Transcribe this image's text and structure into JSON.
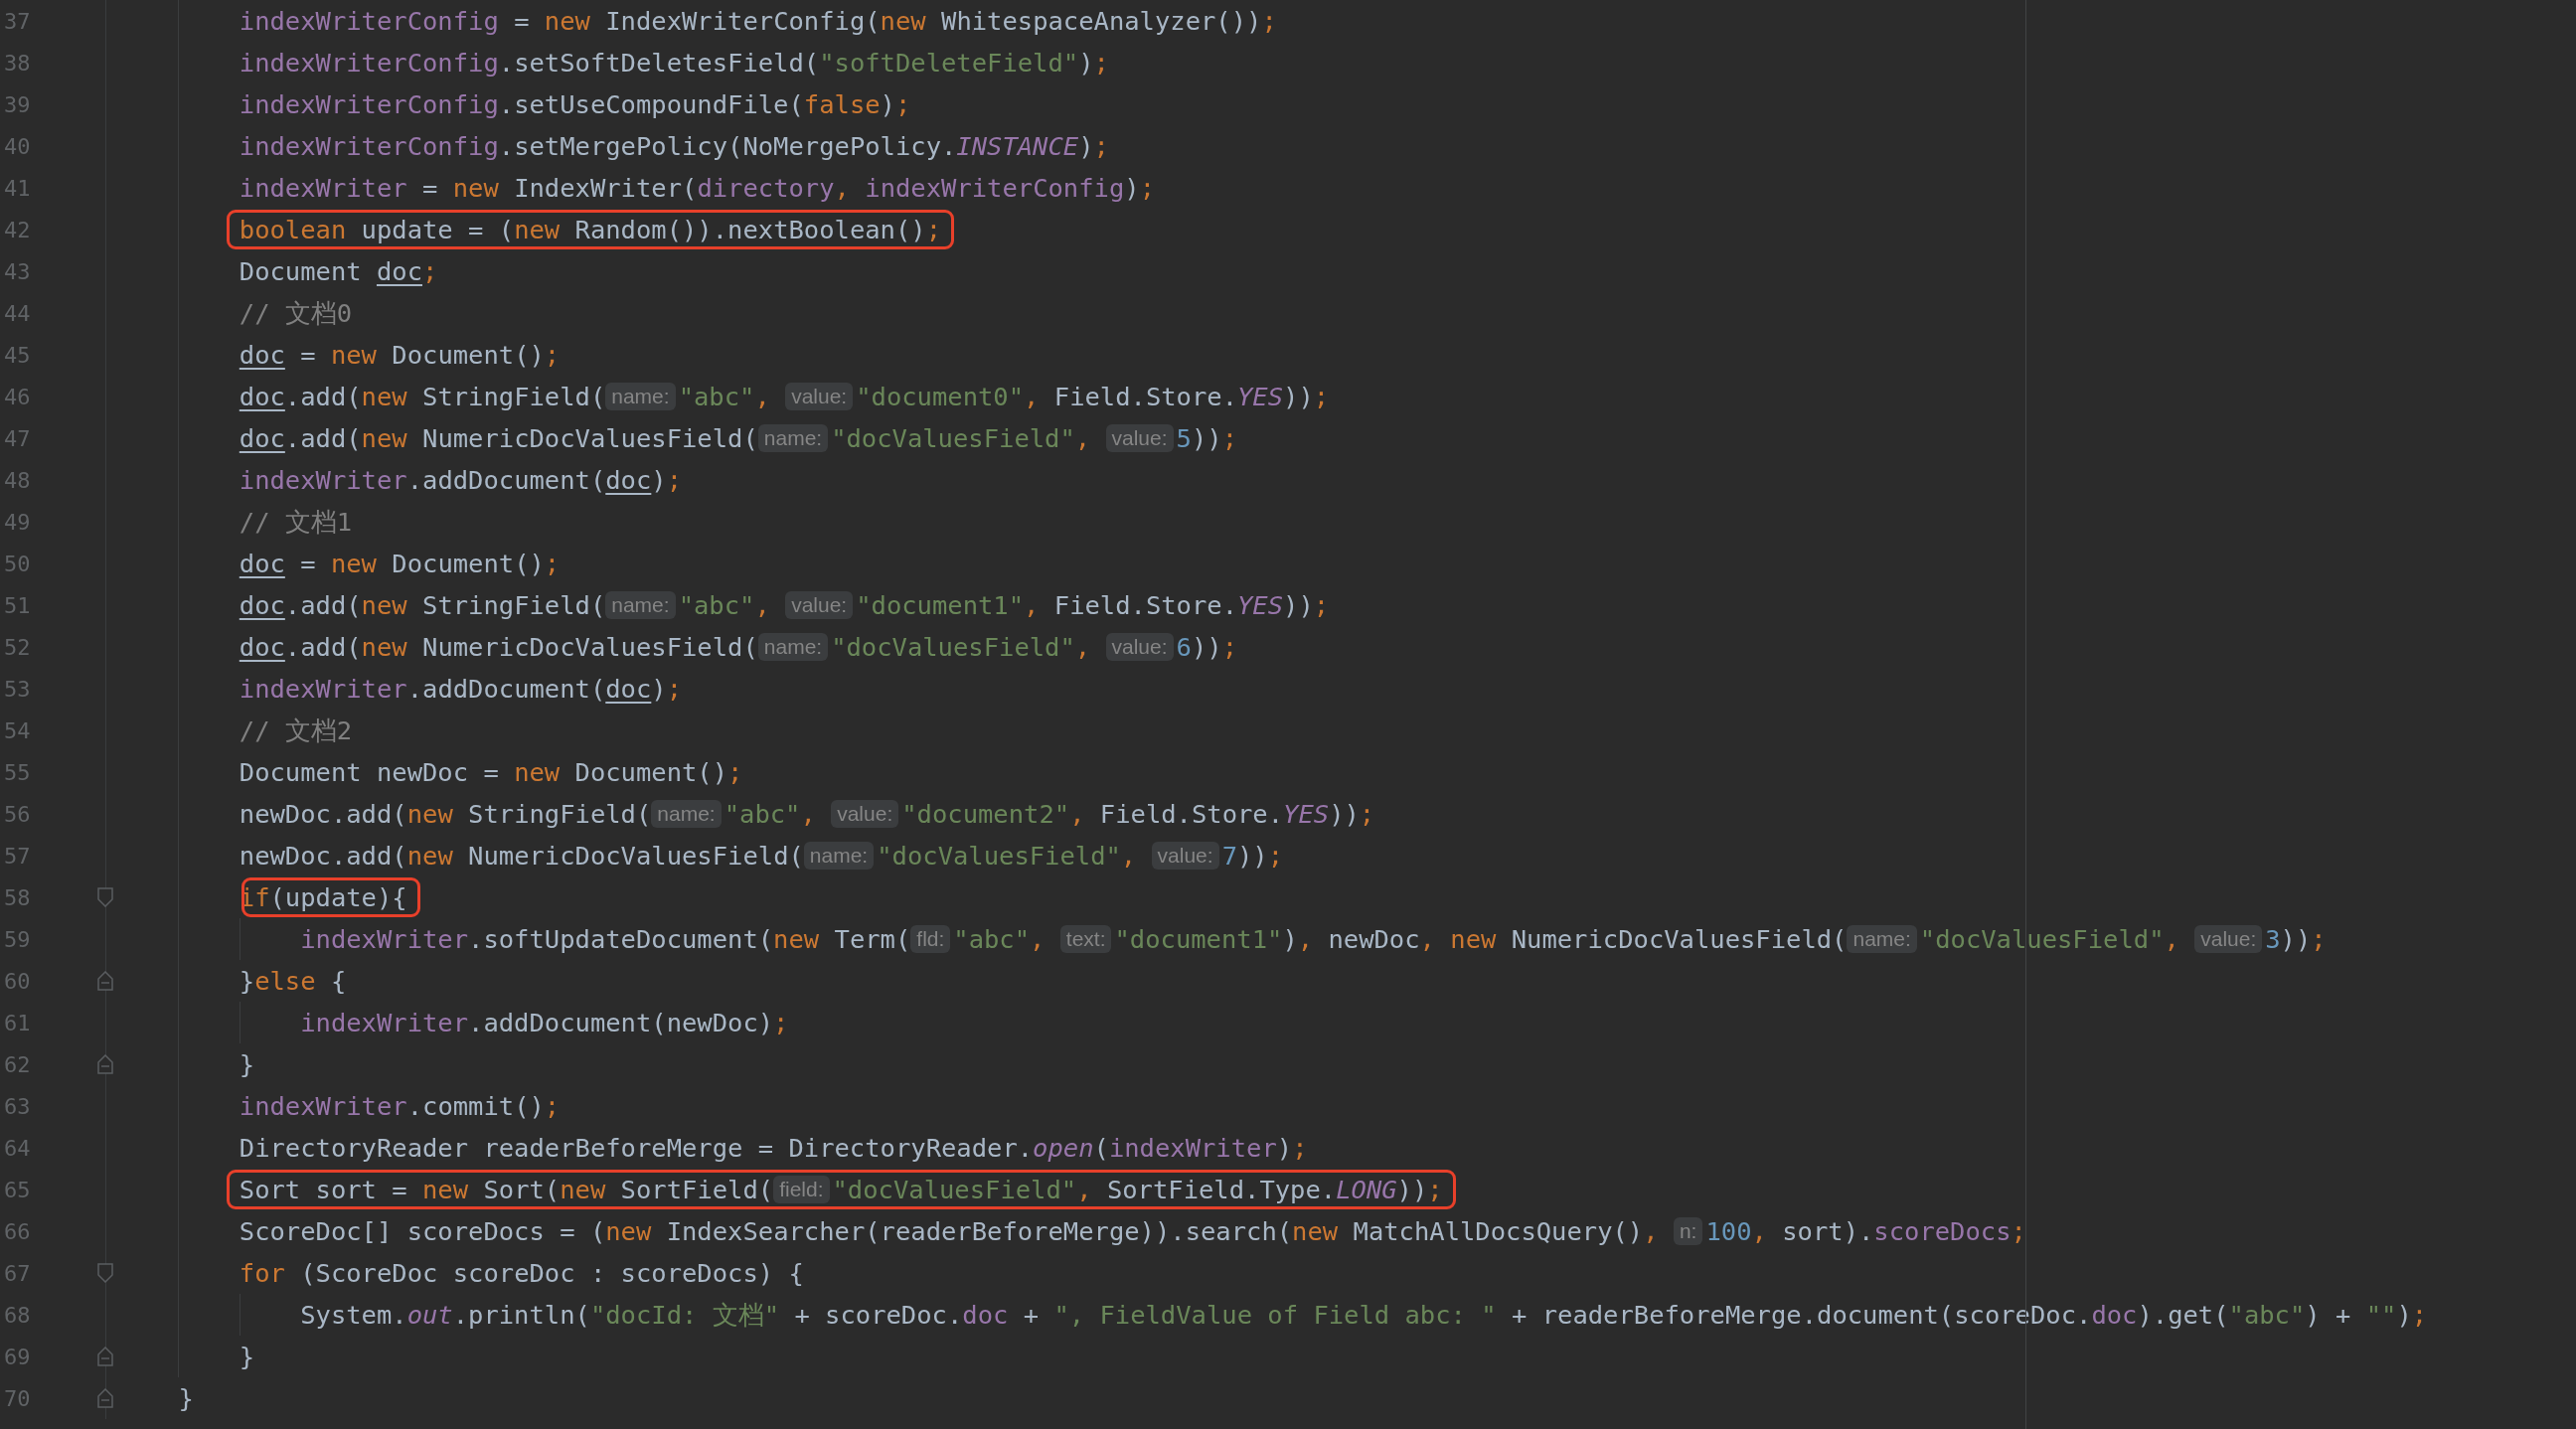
{
  "editor": {
    "lines": [
      {
        "number": "37",
        "kind": "statement",
        "tokens": [
          {
            "kind": "field",
            "t": "indexWriterConfig"
          },
          {
            "kind": "plain",
            "t": " = "
          },
          {
            "kind": "keyword",
            "t": "new"
          },
          {
            "kind": "plain",
            "t": " IndexWriterConfig("
          },
          {
            "kind": "keyword",
            "t": "new"
          },
          {
            "kind": "plain",
            "t": " WhitespaceAnalyzer())"
          },
          {
            "kind": "keyword",
            "t": ";"
          }
        ]
      },
      {
        "number": "38",
        "kind": "statement",
        "tokens": [
          {
            "kind": "field",
            "t": "indexWriterConfig"
          },
          {
            "kind": "plain",
            "t": ".setSoftDeletesField("
          },
          {
            "kind": "string",
            "t": "\"softDeleteField\""
          },
          {
            "kind": "plain",
            "t": ")"
          },
          {
            "kind": "keyword",
            "t": ";"
          }
        ]
      },
      {
        "number": "39",
        "kind": "statement",
        "tokens": [
          {
            "kind": "field",
            "t": "indexWriterConfig"
          },
          {
            "kind": "plain",
            "t": ".setUseCompoundFile("
          },
          {
            "kind": "keyword",
            "t": "false"
          },
          {
            "kind": "plain",
            "t": ")"
          },
          {
            "kind": "keyword",
            "t": ";"
          }
        ]
      },
      {
        "number": "40",
        "kind": "statement",
        "tokens": [
          {
            "kind": "field",
            "t": "indexWriterConfig"
          },
          {
            "kind": "plain",
            "t": ".setMergePolicy(NoMergePolicy."
          },
          {
            "kind": "static",
            "t": "INSTANCE"
          },
          {
            "kind": "plain",
            "t": ")"
          },
          {
            "kind": "keyword",
            "t": ";"
          }
        ]
      },
      {
        "number": "41",
        "kind": "statement",
        "tokens": [
          {
            "kind": "field",
            "t": "indexWriter"
          },
          {
            "kind": "plain",
            "t": " = "
          },
          {
            "kind": "keyword",
            "t": "new"
          },
          {
            "kind": "plain",
            "t": " IndexWriter("
          },
          {
            "kind": "field",
            "t": "directory"
          },
          {
            "kind": "keyword",
            "t": ", "
          },
          {
            "kind": "field",
            "t": "indexWriterConfig"
          },
          {
            "kind": "plain",
            "t": ")"
          },
          {
            "kind": "keyword",
            "t": ";"
          }
        ]
      },
      {
        "number": "42",
        "kind": "statement",
        "tokens": [
          {
            "kind": "box",
            "tokens": [
              {
                "kind": "keyword",
                "t": "boolean"
              },
              {
                "kind": "plain",
                "t": " update = ("
              },
              {
                "kind": "keyword",
                "t": "new"
              },
              {
                "kind": "plain",
                "t": " Random()).nextBoolean()"
              },
              {
                "kind": "keyword",
                "t": ";"
              }
            ]
          }
        ]
      },
      {
        "number": "43",
        "kind": "statement",
        "tokens": [
          {
            "kind": "plain",
            "t": "Document "
          },
          {
            "kind": "variable",
            "t": "doc"
          },
          {
            "kind": "keyword",
            "t": ";"
          }
        ]
      },
      {
        "number": "44",
        "kind": "statement",
        "tokens": [
          {
            "kind": "comment",
            "t": "// 文档0"
          }
        ]
      },
      {
        "number": "45",
        "kind": "statement",
        "tokens": [
          {
            "kind": "variable",
            "t": "doc"
          },
          {
            "kind": "plain",
            "t": " = "
          },
          {
            "kind": "keyword",
            "t": "new"
          },
          {
            "kind": "plain",
            "t": " Document()"
          },
          {
            "kind": "keyword",
            "t": ";"
          }
        ]
      },
      {
        "number": "46",
        "kind": "statement",
        "tokens": [
          {
            "kind": "variable",
            "t": "doc"
          },
          {
            "kind": "plain",
            "t": ".add("
          },
          {
            "kind": "keyword",
            "t": "new"
          },
          {
            "kind": "plain",
            "t": " StringField("
          },
          {
            "kind": "hint",
            "t": "name:"
          },
          {
            "kind": "string",
            "t": "\"abc\""
          },
          {
            "kind": "keyword",
            "t": ", "
          },
          {
            "kind": "hint",
            "t": "value:"
          },
          {
            "kind": "string",
            "t": "\"document0\""
          },
          {
            "kind": "keyword",
            "t": ", "
          },
          {
            "kind": "plain",
            "t": "Field.Store."
          },
          {
            "kind": "static",
            "t": "YES"
          },
          {
            "kind": "plain",
            "t": "))"
          },
          {
            "kind": "keyword",
            "t": ";"
          }
        ]
      },
      {
        "number": "47",
        "kind": "statement",
        "tokens": [
          {
            "kind": "variable",
            "t": "doc"
          },
          {
            "kind": "plain",
            "t": ".add("
          },
          {
            "kind": "keyword",
            "t": "new"
          },
          {
            "kind": "plain",
            "t": " NumericDocValuesField("
          },
          {
            "kind": "hint",
            "t": "name:"
          },
          {
            "kind": "string",
            "t": "\"docValuesField\""
          },
          {
            "kind": "keyword",
            "t": ", "
          },
          {
            "kind": "hint",
            "t": "value:"
          },
          {
            "kind": "number",
            "t": "5"
          },
          {
            "kind": "plain",
            "t": "))"
          },
          {
            "kind": "keyword",
            "t": ";"
          }
        ]
      },
      {
        "number": "48",
        "kind": "statement",
        "tokens": [
          {
            "kind": "field",
            "t": "indexWriter"
          },
          {
            "kind": "plain",
            "t": ".addDocument("
          },
          {
            "kind": "variable",
            "t": "doc"
          },
          {
            "kind": "plain",
            "t": ")"
          },
          {
            "kind": "keyword",
            "t": ";"
          }
        ]
      },
      {
        "number": "49",
        "kind": "statement",
        "tokens": [
          {
            "kind": "comment",
            "t": "// 文档1"
          }
        ]
      },
      {
        "number": "50",
        "kind": "statement",
        "tokens": [
          {
            "kind": "variable",
            "t": "doc"
          },
          {
            "kind": "plain",
            "t": " = "
          },
          {
            "kind": "keyword",
            "t": "new"
          },
          {
            "kind": "plain",
            "t": " Document()"
          },
          {
            "kind": "keyword",
            "t": ";"
          }
        ]
      },
      {
        "number": "51",
        "kind": "statement",
        "tokens": [
          {
            "kind": "variable",
            "t": "doc"
          },
          {
            "kind": "plain",
            "t": ".add("
          },
          {
            "kind": "keyword",
            "t": "new"
          },
          {
            "kind": "plain",
            "t": " StringField("
          },
          {
            "kind": "hint",
            "t": "name:"
          },
          {
            "kind": "string",
            "t": "\"abc\""
          },
          {
            "kind": "keyword",
            "t": ", "
          },
          {
            "kind": "hint",
            "t": "value:"
          },
          {
            "kind": "string",
            "t": "\"document1\""
          },
          {
            "kind": "keyword",
            "t": ", "
          },
          {
            "kind": "plain",
            "t": "Field.Store."
          },
          {
            "kind": "static",
            "t": "YES"
          },
          {
            "kind": "plain",
            "t": "))"
          },
          {
            "kind": "keyword",
            "t": ";"
          }
        ]
      },
      {
        "number": "52",
        "kind": "statement",
        "tokens": [
          {
            "kind": "variable",
            "t": "doc"
          },
          {
            "kind": "plain",
            "t": ".add("
          },
          {
            "kind": "keyword",
            "t": "new"
          },
          {
            "kind": "plain",
            "t": " NumericDocValuesField("
          },
          {
            "kind": "hint",
            "t": "name:"
          },
          {
            "kind": "string",
            "t": "\"docValuesField\""
          },
          {
            "kind": "keyword",
            "t": ", "
          },
          {
            "kind": "hint",
            "t": "value:"
          },
          {
            "kind": "number",
            "t": "6"
          },
          {
            "kind": "plain",
            "t": "))"
          },
          {
            "kind": "keyword",
            "t": ";"
          }
        ]
      },
      {
        "number": "53",
        "kind": "statement",
        "tokens": [
          {
            "kind": "field",
            "t": "indexWriter"
          },
          {
            "kind": "plain",
            "t": ".addDocument("
          },
          {
            "kind": "variable",
            "t": "doc"
          },
          {
            "kind": "plain",
            "t": ")"
          },
          {
            "kind": "keyword",
            "t": ";"
          }
        ]
      },
      {
        "number": "54",
        "kind": "statement",
        "tokens": [
          {
            "kind": "comment",
            "t": "// 文档2"
          }
        ]
      },
      {
        "number": "55",
        "kind": "statement",
        "tokens": [
          {
            "kind": "plain",
            "t": "Document newDoc = "
          },
          {
            "kind": "keyword",
            "t": "new"
          },
          {
            "kind": "plain",
            "t": " Document()"
          },
          {
            "kind": "keyword",
            "t": ";"
          }
        ]
      },
      {
        "number": "56",
        "kind": "statement",
        "tokens": [
          {
            "kind": "plain",
            "t": "newDoc.add("
          },
          {
            "kind": "keyword",
            "t": "new"
          },
          {
            "kind": "plain",
            "t": " StringField("
          },
          {
            "kind": "hint",
            "t": "name:"
          },
          {
            "kind": "string",
            "t": "\"abc\""
          },
          {
            "kind": "keyword",
            "t": ", "
          },
          {
            "kind": "hint",
            "t": "value:"
          },
          {
            "kind": "string",
            "t": "\"document2\""
          },
          {
            "kind": "keyword",
            "t": ", "
          },
          {
            "kind": "plain",
            "t": "Field.Store."
          },
          {
            "kind": "static",
            "t": "YES"
          },
          {
            "kind": "plain",
            "t": "))"
          },
          {
            "kind": "keyword",
            "t": ";"
          }
        ]
      },
      {
        "number": "57",
        "kind": "statement",
        "tokens": [
          {
            "kind": "plain",
            "t": "newDoc.add("
          },
          {
            "kind": "keyword",
            "t": "new"
          },
          {
            "kind": "plain",
            "t": " NumericDocValuesField("
          },
          {
            "kind": "hint",
            "t": "name:"
          },
          {
            "kind": "string",
            "t": "\"docValuesField\""
          },
          {
            "kind": "keyword",
            "t": ", "
          },
          {
            "kind": "hint",
            "t": "value:"
          },
          {
            "kind": "number",
            "t": "7"
          },
          {
            "kind": "plain",
            "t": "))"
          },
          {
            "kind": "keyword",
            "t": ";"
          }
        ]
      },
      {
        "number": "58",
        "kind": "statement",
        "fold_marker": {
          "kind": "open"
        },
        "tokens": [
          {
            "kind": "keyword",
            "t": "i"
          },
          {
            "kind": "box",
            "tokens": [
              {
                "kind": "keyword",
                "t": "f"
              },
              {
                "kind": "plain",
                "t": "(update){"
              }
            ]
          }
        ]
      },
      {
        "number": "59",
        "kind": "nested",
        "tokens": [
          {
            "kind": "field",
            "t": "indexWriter"
          },
          {
            "kind": "plain",
            "t": ".softUpdateDocument("
          },
          {
            "kind": "keyword",
            "t": "new"
          },
          {
            "kind": "plain",
            "t": " Term("
          },
          {
            "kind": "hint",
            "t": "fld:"
          },
          {
            "kind": "string",
            "t": "\"abc\""
          },
          {
            "kind": "keyword",
            "t": ", "
          },
          {
            "kind": "hint",
            "t": "text:"
          },
          {
            "kind": "string",
            "t": "\"document1\""
          },
          {
            "kind": "plain",
            "t": ")"
          },
          {
            "kind": "keyword",
            "t": ", "
          },
          {
            "kind": "plain",
            "t": "newDoc"
          },
          {
            "kind": "keyword",
            "t": ", "
          },
          {
            "kind": "keyword",
            "t": "new"
          },
          {
            "kind": "plain",
            "t": " NumericDocValuesField("
          },
          {
            "kind": "hint",
            "t": "name:"
          },
          {
            "kind": "string",
            "t": "\"docValuesField\""
          },
          {
            "kind": "keyword",
            "t": ", "
          },
          {
            "kind": "hint",
            "t": "value:"
          },
          {
            "kind": "number",
            "t": "3"
          },
          {
            "kind": "plain",
            "t": "))"
          },
          {
            "kind": "keyword",
            "t": ";"
          }
        ]
      },
      {
        "number": "60",
        "kind": "statement",
        "fold_marker": {
          "kind": "close"
        },
        "tokens": [
          {
            "kind": "plain",
            "t": "}"
          },
          {
            "kind": "keyword",
            "t": "else"
          },
          {
            "kind": "plain",
            "t": " {"
          }
        ]
      },
      {
        "number": "61",
        "kind": "nested",
        "tokens": [
          {
            "kind": "field",
            "t": "indexWriter"
          },
          {
            "kind": "plain",
            "t": ".addDocument(newDoc)"
          },
          {
            "kind": "keyword",
            "t": ";"
          }
        ]
      },
      {
        "number": "62",
        "kind": "statement",
        "fold_marker": {
          "kind": "close"
        },
        "tokens": [
          {
            "kind": "plain",
            "t": "}"
          }
        ]
      },
      {
        "number": "63",
        "kind": "statement",
        "tokens": [
          {
            "kind": "field",
            "t": "indexWriter"
          },
          {
            "kind": "plain",
            "t": ".commit()"
          },
          {
            "kind": "keyword",
            "t": ";"
          }
        ]
      },
      {
        "number": "64",
        "kind": "statement",
        "tokens": [
          {
            "kind": "plain",
            "t": "DirectoryReader readerBeforeMerge = DirectoryReader."
          },
          {
            "kind": "static",
            "t": "open"
          },
          {
            "kind": "plain",
            "t": "("
          },
          {
            "kind": "field",
            "t": "indexWriter"
          },
          {
            "kind": "plain",
            "t": ")"
          },
          {
            "kind": "keyword",
            "t": ";"
          }
        ]
      },
      {
        "number": "65",
        "kind": "statement",
        "tokens": [
          {
            "kind": "box",
            "tokens": [
              {
                "kind": "plain",
                "t": "Sort sort = "
              },
              {
                "kind": "keyword",
                "t": "new"
              },
              {
                "kind": "plain",
                "t": " Sort("
              },
              {
                "kind": "keyword",
                "t": "new"
              },
              {
                "kind": "plain",
                "t": " SortField("
              },
              {
                "kind": "hint",
                "t": "field:"
              },
              {
                "kind": "string",
                "t": "\"docValuesField\""
              },
              {
                "kind": "keyword",
                "t": ", "
              },
              {
                "kind": "plain",
                "t": "SortField.Type."
              },
              {
                "kind": "static",
                "t": "LONG"
              },
              {
                "kind": "plain",
                "t": "))"
              },
              {
                "kind": "keyword",
                "t": ";"
              }
            ]
          }
        ]
      },
      {
        "number": "66",
        "kind": "statement",
        "tokens": [
          {
            "kind": "plain",
            "t": "ScoreDoc[] scoreDocs = ("
          },
          {
            "kind": "keyword",
            "t": "new"
          },
          {
            "kind": "plain",
            "t": " IndexSearcher(readerBeforeMerge)).search("
          },
          {
            "kind": "keyword",
            "t": "new"
          },
          {
            "kind": "plain",
            "t": " MatchAllDocsQuery()"
          },
          {
            "kind": "keyword",
            "t": ", "
          },
          {
            "kind": "hint",
            "t": "n:"
          },
          {
            "kind": "number",
            "t": "100"
          },
          {
            "kind": "keyword",
            "t": ", "
          },
          {
            "kind": "plain",
            "t": "sort)."
          },
          {
            "kind": "field",
            "t": "scoreDocs"
          },
          {
            "kind": "keyword",
            "t": ";"
          }
        ]
      },
      {
        "number": "67",
        "kind": "statement",
        "fold_marker": {
          "kind": "open"
        },
        "tokens": [
          {
            "kind": "keyword",
            "t": "for"
          },
          {
            "kind": "plain",
            "t": " (ScoreDoc scoreDoc : scoreDocs) {"
          }
        ]
      },
      {
        "number": "68",
        "kind": "nested",
        "tokens": [
          {
            "kind": "plain",
            "t": "System."
          },
          {
            "kind": "static",
            "t": "out"
          },
          {
            "kind": "plain",
            "t": ".println("
          },
          {
            "kind": "string",
            "t": "\"docId: 文档\""
          },
          {
            "kind": "plain",
            "t": " + scoreDoc."
          },
          {
            "kind": "field",
            "t": "doc"
          },
          {
            "kind": "plain",
            "t": " + "
          },
          {
            "kind": "string",
            "t": "\", FieldValue of Field abc: \""
          },
          {
            "kind": "plain",
            "t": " + readerBeforeMerge.document(scoreDoc."
          },
          {
            "kind": "field",
            "t": "doc"
          },
          {
            "kind": "plain",
            "t": ").get("
          },
          {
            "kind": "string",
            "t": "\"abc\""
          },
          {
            "kind": "plain",
            "t": ") + "
          },
          {
            "kind": "string",
            "t": "\"\""
          },
          {
            "kind": "plain",
            "t": ")"
          },
          {
            "kind": "keyword",
            "t": ";"
          }
        ]
      },
      {
        "number": "69",
        "kind": "statement",
        "fold_marker": {
          "kind": "close"
        },
        "tokens": [
          {
            "kind": "plain",
            "t": "}"
          }
        ]
      },
      {
        "number": "70",
        "kind": "closing",
        "fold_marker": {
          "kind": "close"
        },
        "tokens": [
          {
            "kind": "plain",
            "t": "}"
          }
        ]
      }
    ]
  }
}
